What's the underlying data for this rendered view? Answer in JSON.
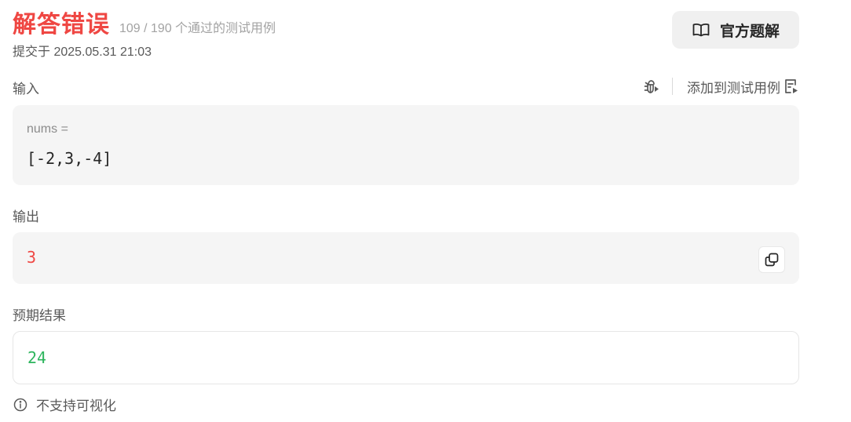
{
  "header": {
    "status": "解答错误",
    "passed": "109 / 190 个通过的测试用例",
    "submitted": "提交于 2025.05.31 21:03",
    "solution_button": "官方题解"
  },
  "input": {
    "label": "输入",
    "add_to_testcase": "添加到测试用例",
    "var_name": "nums =",
    "var_value": "[-2,3,-4]"
  },
  "output": {
    "label": "输出",
    "value": "3"
  },
  "expected": {
    "label": "预期结果",
    "value": "24"
  },
  "footer": {
    "note": "不支持可视化"
  },
  "colors": {
    "error": "#ef4743",
    "success": "#2db55d"
  },
  "icons": {
    "solution": "book-open-icon",
    "debug": "bug-play-icon",
    "add_testcase": "list-play-icon",
    "copy": "copy-icon",
    "info": "info-circle-icon"
  }
}
